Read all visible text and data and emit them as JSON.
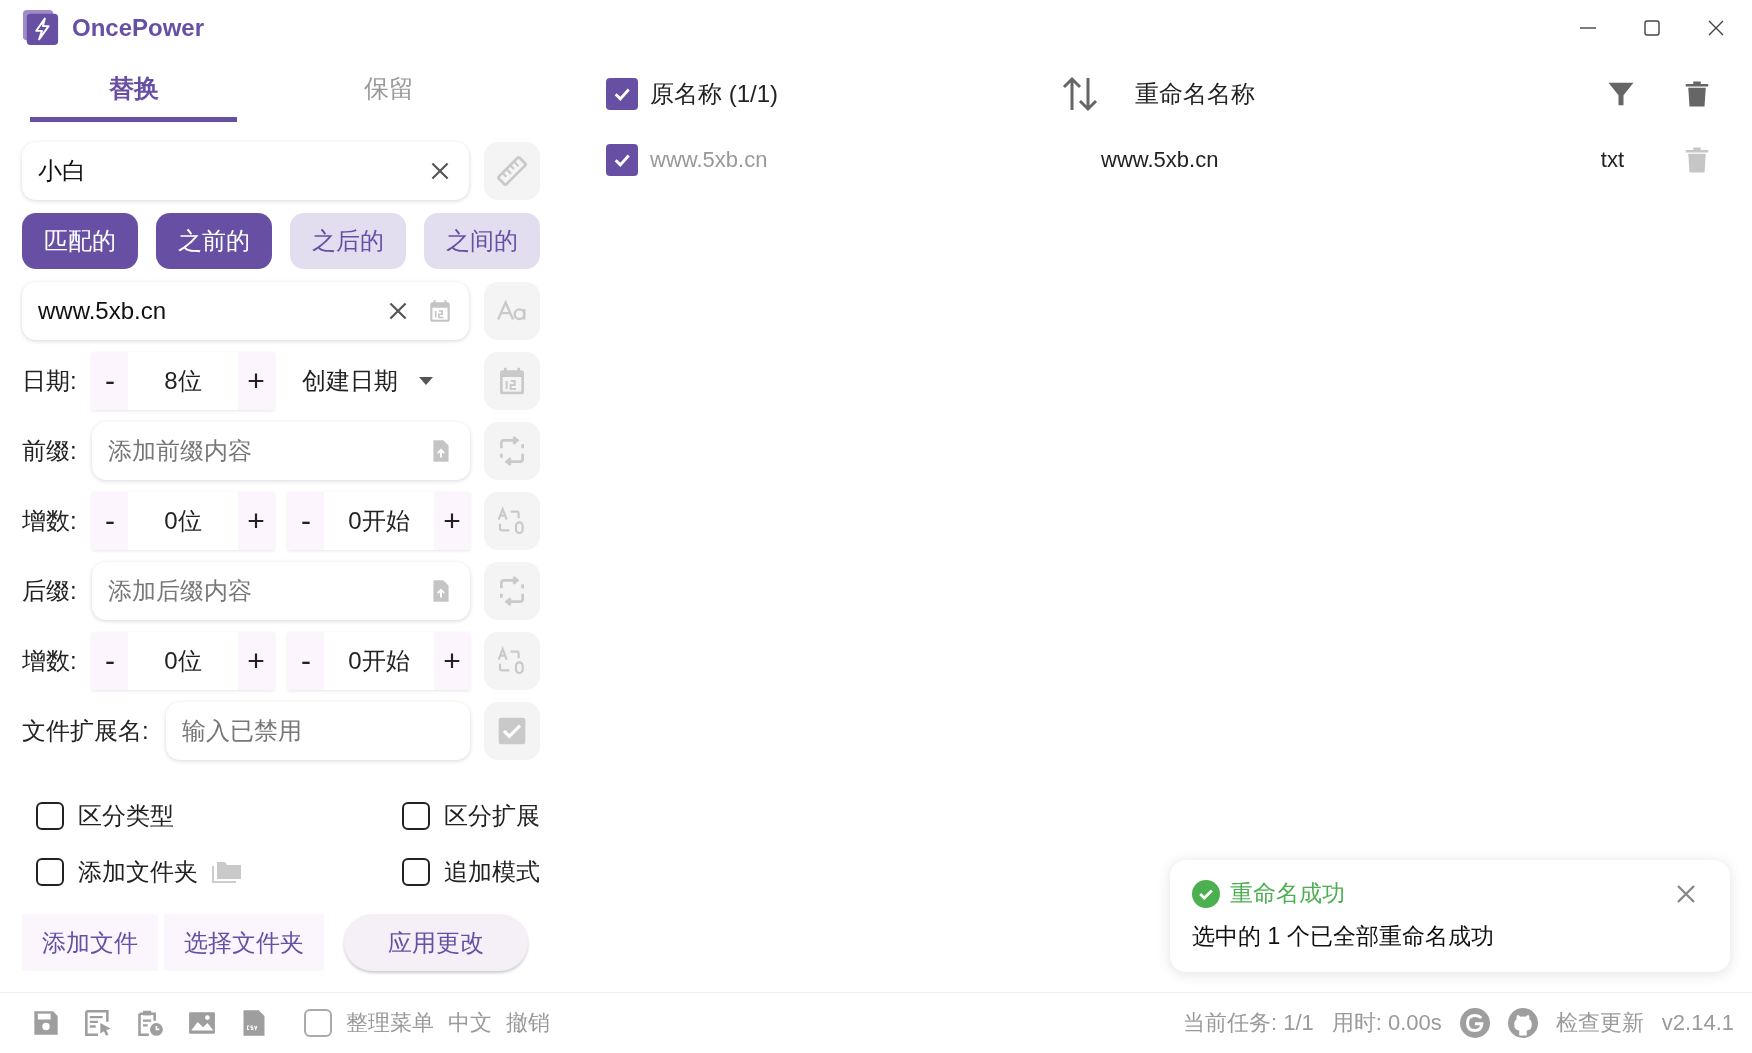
{
  "app": {
    "title": "OncePower"
  },
  "tabs": [
    {
      "label": "替换",
      "selected": true
    },
    {
      "label": "保留",
      "selected": false
    }
  ],
  "find_field": {
    "value": "小白"
  },
  "mode_buttons": [
    {
      "label": "匹配的",
      "selected": true
    },
    {
      "label": "之前的",
      "selected": true
    },
    {
      "label": "之后的",
      "selected": false
    },
    {
      "label": "之间的",
      "selected": false
    }
  ],
  "replace_field": {
    "value": "www.5xb.cn"
  },
  "date_row": {
    "label": "日期:",
    "stepper": {
      "minus": "-",
      "value": "8位",
      "plus": "+"
    },
    "source": "创建日期"
  },
  "prefix_row": {
    "label": "前缀:",
    "placeholder": "添加前缀内容"
  },
  "prefix_counter": {
    "label": "增数:",
    "steppers": [
      {
        "minus": "-",
        "value": "0位",
        "plus": "+"
      },
      {
        "minus": "-",
        "value": "0开始",
        "plus": "+"
      }
    ]
  },
  "suffix_row": {
    "label": "后缀:",
    "placeholder": "添加后缀内容"
  },
  "suffix_counter": {
    "label": "增数:",
    "steppers": [
      {
        "minus": "-",
        "value": "0位",
        "plus": "+"
      },
      {
        "minus": "-",
        "value": "0开始",
        "plus": "+"
      }
    ]
  },
  "extension_row": {
    "label": "文件扩展名:",
    "placeholder": "输入已禁用"
  },
  "options": [
    {
      "label": "区分类型",
      "checked": false,
      "kind": "plain"
    },
    {
      "label": "区分扩展",
      "checked": false,
      "kind": "plain"
    },
    {
      "label": "添加文件夹",
      "checked": false,
      "kind": "folder"
    },
    {
      "label": "追加模式",
      "checked": false,
      "kind": "plain"
    }
  ],
  "action_buttons": [
    {
      "label": "添加文件",
      "kind": "flat"
    },
    {
      "label": "选择文件夹",
      "kind": "flat"
    },
    {
      "label": "应用更改",
      "kind": "raised"
    }
  ],
  "table": {
    "header_checked": true,
    "columns": [
      "原名称 (1/1)",
      "重命名名称"
    ],
    "rows": [
      {
        "checked": true,
        "original": "www.5xb.cn",
        "renamed": "www.5xb.cn",
        "extension": "txt"
      }
    ]
  },
  "toast": {
    "title": "重命名成功",
    "message": "选中的 1 个已全部重命名成功"
  },
  "footer": {
    "organize_menu": {
      "label": "整理菜单",
      "checked": false
    },
    "language": "中文",
    "undo": "撤销",
    "task": "当前任务: 1/1",
    "elapsed": "用时: 0.00s",
    "check_update": "检查更新",
    "version": "v2.14.1"
  }
}
